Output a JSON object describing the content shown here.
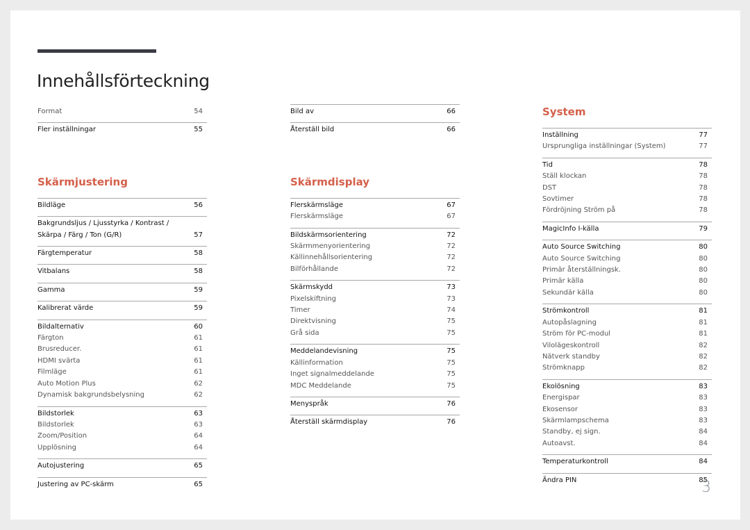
{
  "title": "Innehållsförteckning",
  "page_number": "3",
  "colors": {
    "heading": "#d4604a",
    "title_bar": "#3b3b45"
  },
  "columns": [
    {
      "blocks": [
        {
          "type": "groups",
          "groups": [
            {
              "border": false,
              "entries": [
                {
                  "label": "Format",
                  "page": "54",
                  "level": "sub"
                }
              ]
            },
            {
              "border": true,
              "entries": [
                {
                  "label": "Fler inställningar",
                  "page": "55",
                  "level": "main"
                }
              ]
            }
          ]
        },
        {
          "type": "heading",
          "text": "Skärmjustering"
        },
        {
          "type": "groups",
          "groups": [
            {
              "border": true,
              "entries": [
                {
                  "label": "Bildläge",
                  "page": "56",
                  "level": "main"
                }
              ]
            },
            {
              "border": true,
              "entries": [
                {
                  "label": "Bakgrundsljus / Ljusstyrka / Kontrast / Skärpa / Färg / Ton (G/R)",
                  "page": "57",
                  "level": "main"
                }
              ]
            },
            {
              "border": true,
              "entries": [
                {
                  "label": "Färgtemperatur",
                  "page": "58",
                  "level": "main"
                }
              ]
            },
            {
              "border": true,
              "entries": [
                {
                  "label": "Vitbalans",
                  "page": "58",
                  "level": "main"
                }
              ]
            },
            {
              "border": true,
              "entries": [
                {
                  "label": "Gamma",
                  "page": "59",
                  "level": "main"
                }
              ]
            },
            {
              "border": true,
              "entries": [
                {
                  "label": "Kalibrerat värde",
                  "page": "59",
                  "level": "main"
                }
              ]
            },
            {
              "border": true,
              "entries": [
                {
                  "label": "Bildalternativ",
                  "page": "60",
                  "level": "main"
                },
                {
                  "label": "Färgton",
                  "page": "61",
                  "level": "sub"
                },
                {
                  "label": "Brusreducer.",
                  "page": "61",
                  "level": "sub"
                },
                {
                  "label": "HDMI svärta",
                  "page": "61",
                  "level": "sub"
                },
                {
                  "label": "Filmläge",
                  "page": "61",
                  "level": "sub"
                },
                {
                  "label": "Auto Motion Plus",
                  "page": "62",
                  "level": "sub"
                },
                {
                  "label": "Dynamisk bakgrundsbelysning",
                  "page": "62",
                  "level": "sub"
                }
              ]
            },
            {
              "border": true,
              "entries": [
                {
                  "label": "Bildstorlek",
                  "page": "63",
                  "level": "main"
                },
                {
                  "label": "Bildstorlek",
                  "page": "63",
                  "level": "sub"
                },
                {
                  "label": "Zoom/Position",
                  "page": "64",
                  "level": "sub"
                },
                {
                  "label": "Upplösning",
                  "page": "64",
                  "level": "sub"
                }
              ]
            },
            {
              "border": true,
              "entries": [
                {
                  "label": "Autojustering",
                  "page": "65",
                  "level": "main"
                }
              ]
            },
            {
              "border": true,
              "entries": [
                {
                  "label": "Justering av PC-skärm",
                  "page": "65",
                  "level": "main"
                }
              ]
            }
          ]
        }
      ]
    },
    {
      "blocks": [
        {
          "type": "groups",
          "groups": [
            {
              "border": true,
              "entries": [
                {
                  "label": "Bild av",
                  "page": "66",
                  "level": "main"
                }
              ]
            },
            {
              "border": true,
              "entries": [
                {
                  "label": "Återställ bild",
                  "page": "66",
                  "level": "main"
                }
              ]
            }
          ]
        },
        {
          "type": "heading",
          "text": "Skärmdisplay"
        },
        {
          "type": "groups",
          "groups": [
            {
              "border": true,
              "entries": [
                {
                  "label": "Flerskärmsläge",
                  "page": "67",
                  "level": "main"
                },
                {
                  "label": "Flerskärmsläge",
                  "page": "67",
                  "level": "sub"
                }
              ]
            },
            {
              "border": true,
              "entries": [
                {
                  "label": "Bildskärmsorientering",
                  "page": "72",
                  "level": "main"
                },
                {
                  "label": "Skärmmenyorientering",
                  "page": "72",
                  "level": "sub"
                },
                {
                  "label": "Källinnehållsorientering",
                  "page": "72",
                  "level": "sub"
                },
                {
                  "label": "Bilförhållande",
                  "page": "72",
                  "level": "sub"
                }
              ]
            },
            {
              "border": true,
              "entries": [
                {
                  "label": "Skärmskydd",
                  "page": "73",
                  "level": "main"
                },
                {
                  "label": "Pixelskiftning",
                  "page": "73",
                  "level": "sub"
                },
                {
                  "label": "Timer",
                  "page": "74",
                  "level": "sub"
                },
                {
                  "label": "Direktvisning",
                  "page": "75",
                  "level": "sub"
                },
                {
                  "label": "Grå sida",
                  "page": "75",
                  "level": "sub"
                }
              ]
            },
            {
              "border": true,
              "entries": [
                {
                  "label": "Meddelandevisning",
                  "page": "75",
                  "level": "main"
                },
                {
                  "label": "Källinformation",
                  "page": "75",
                  "level": "sub"
                },
                {
                  "label": "Inget signalmeddelande",
                  "page": "75",
                  "level": "sub"
                },
                {
                  "label": "MDC Meddelande",
                  "page": "75",
                  "level": "sub"
                }
              ]
            },
            {
              "border": true,
              "entries": [
                {
                  "label": "Menyspråk",
                  "page": "76",
                  "level": "main"
                }
              ]
            },
            {
              "border": true,
              "entries": [
                {
                  "label": "Återställ skärmdisplay",
                  "page": "76",
                  "level": "main"
                }
              ]
            }
          ]
        }
      ]
    },
    {
      "blocks": [
        {
          "type": "heading",
          "text": "System"
        },
        {
          "type": "groups",
          "groups": [
            {
              "border": true,
              "entries": [
                {
                  "label": "Inställning",
                  "page": "77",
                  "level": "main"
                },
                {
                  "label": "Ursprungliga inställningar (System)",
                  "page": "77",
                  "level": "sub"
                }
              ]
            },
            {
              "border": true,
              "entries": [
                {
                  "label": "Tid",
                  "page": "78",
                  "level": "main"
                },
                {
                  "label": "Ställ klockan",
                  "page": "78",
                  "level": "sub"
                },
                {
                  "label": "DST",
                  "page": "78",
                  "level": "sub"
                },
                {
                  "label": "Sovtimer",
                  "page": "78",
                  "level": "sub"
                },
                {
                  "label": "Fördröjning Ström på",
                  "page": "78",
                  "level": "sub"
                }
              ]
            },
            {
              "border": true,
              "entries": [
                {
                  "label": "MagicInfo I-källa",
                  "page": "79",
                  "level": "main"
                }
              ]
            },
            {
              "border": true,
              "entries": [
                {
                  "label": "Auto Source Switching",
                  "page": "80",
                  "level": "main"
                },
                {
                  "label": "Auto Source Switching",
                  "page": "80",
                  "level": "sub"
                },
                {
                  "label": "Primär återställningsk.",
                  "page": "80",
                  "level": "sub"
                },
                {
                  "label": "Primär källa",
                  "page": "80",
                  "level": "sub"
                },
                {
                  "label": "Sekundär källa",
                  "page": "80",
                  "level": "sub"
                }
              ]
            },
            {
              "border": true,
              "entries": [
                {
                  "label": "Strömkontroll",
                  "page": "81",
                  "level": "main"
                },
                {
                  "label": "Autopåslagning",
                  "page": "81",
                  "level": "sub"
                },
                {
                  "label": "Ström för PC-modul",
                  "page": "81",
                  "level": "sub"
                },
                {
                  "label": "Vilolägeskontroll",
                  "page": "82",
                  "level": "sub"
                },
                {
                  "label": "Nätverk standby",
                  "page": "82",
                  "level": "sub"
                },
                {
                  "label": "Strömknapp",
                  "page": "82",
                  "level": "sub"
                }
              ]
            },
            {
              "border": true,
              "entries": [
                {
                  "label": "Ekolösning",
                  "page": "83",
                  "level": "main"
                },
                {
                  "label": "Energispar",
                  "page": "83",
                  "level": "sub"
                },
                {
                  "label": "Ekosensor",
                  "page": "83",
                  "level": "sub"
                },
                {
                  "label": "Skärmlampschema",
                  "page": "83",
                  "level": "sub"
                },
                {
                  "label": "Standby, ej sign.",
                  "page": "84",
                  "level": "sub"
                },
                {
                  "label": "Autoavst.",
                  "page": "84",
                  "level": "sub"
                }
              ]
            },
            {
              "border": true,
              "entries": [
                {
                  "label": "Temperaturkontroll",
                  "page": "84",
                  "level": "main"
                }
              ]
            },
            {
              "border": true,
              "entries": [
                {
                  "label": "Ändra PIN",
                  "page": "85",
                  "level": "main"
                }
              ]
            }
          ]
        }
      ]
    }
  ]
}
